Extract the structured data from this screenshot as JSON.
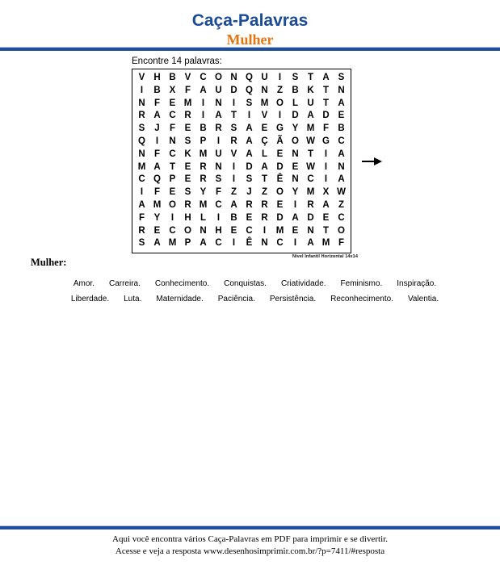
{
  "header": {
    "title": "Caça-Palavras",
    "subtitle": "Mulher"
  },
  "puzzle": {
    "find_label": "Encontre 14 palavras:",
    "caption": "Nível Infantil Horizontal 14x14",
    "arrow_icon": "right-arrow-icon",
    "size": "14x14",
    "grid": [
      [
        "V",
        "H",
        "B",
        "V",
        "C",
        "O",
        "N",
        "Q",
        "U",
        "I",
        "S",
        "T",
        "A",
        "S"
      ],
      [
        "I",
        "B",
        "X",
        "F",
        "A",
        "U",
        "D",
        "Q",
        "N",
        "Z",
        "B",
        "K",
        "T",
        "N"
      ],
      [
        "N",
        "F",
        "E",
        "M",
        "I",
        "N",
        "I",
        "S",
        "M",
        "O",
        "L",
        "U",
        "T",
        "A"
      ],
      [
        "R",
        "A",
        "C",
        "R",
        "I",
        "A",
        "T",
        "I",
        "V",
        "I",
        "D",
        "A",
        "D",
        "E"
      ],
      [
        "S",
        "J",
        "F",
        "E",
        "B",
        "R",
        "S",
        "A",
        "E",
        "G",
        "Y",
        "M",
        "F",
        "B"
      ],
      [
        "Q",
        "I",
        "N",
        "S",
        "P",
        "I",
        "R",
        "A",
        "Ç",
        "Ã",
        "O",
        "W",
        "G",
        "C"
      ],
      [
        "N",
        "F",
        "C",
        "K",
        "M",
        "U",
        "V",
        "A",
        "L",
        "E",
        "N",
        "T",
        "I",
        "A"
      ],
      [
        "M",
        "A",
        "T",
        "E",
        "R",
        "N",
        "I",
        "D",
        "A",
        "D",
        "E",
        "W",
        "I",
        "N"
      ],
      [
        "C",
        "Q",
        "P",
        "E",
        "R",
        "S",
        "I",
        "S",
        "T",
        "Ê",
        "N",
        "C",
        "I",
        "A"
      ],
      [
        "I",
        "F",
        "E",
        "S",
        "Y",
        "F",
        "Z",
        "J",
        "Z",
        "O",
        "Y",
        "M",
        "X",
        "W"
      ],
      [
        "A",
        "M",
        "O",
        "R",
        "M",
        "C",
        "A",
        "R",
        "R",
        "E",
        "I",
        "R",
        "A",
        "Z"
      ],
      [
        "F",
        "Y",
        "I",
        "H",
        "L",
        "I",
        "B",
        "E",
        "R",
        "D",
        "A",
        "D",
        "E",
        "C"
      ],
      [
        "R",
        "E",
        "C",
        "O",
        "N",
        "H",
        "E",
        "C",
        "I",
        "M",
        "E",
        "N",
        "T",
        "O"
      ],
      [
        "S",
        "A",
        "M",
        "P",
        "A",
        "C",
        "I",
        "Ê",
        "N",
        "C",
        "I",
        "A",
        "M",
        "F"
      ]
    ]
  },
  "wordlist": {
    "heading": "Mulher:",
    "rows": [
      [
        "Amor.",
        "Carreira.",
        "Conhecimento.",
        "Conquistas.",
        "Criatividade.",
        "Feminismo.",
        "Inspiração."
      ],
      [
        "Liberdade.",
        "Luta.",
        "Maternidade.",
        "Paciência.",
        "Persistência.",
        "Reconhecimento.",
        "Valentia."
      ]
    ]
  },
  "footer": {
    "line1": "Aqui você encontra vários Caça-Palavras em PDF para imprimir e se divertir.",
    "line2": "Acesse e veja a resposta  www.desenhosimprimir.com.br/?p=7411/#resposta"
  },
  "colors": {
    "title_blue": "#1a4b97",
    "subtitle_orange": "#e8730d",
    "rule_blue": "#1f4e9c"
  }
}
